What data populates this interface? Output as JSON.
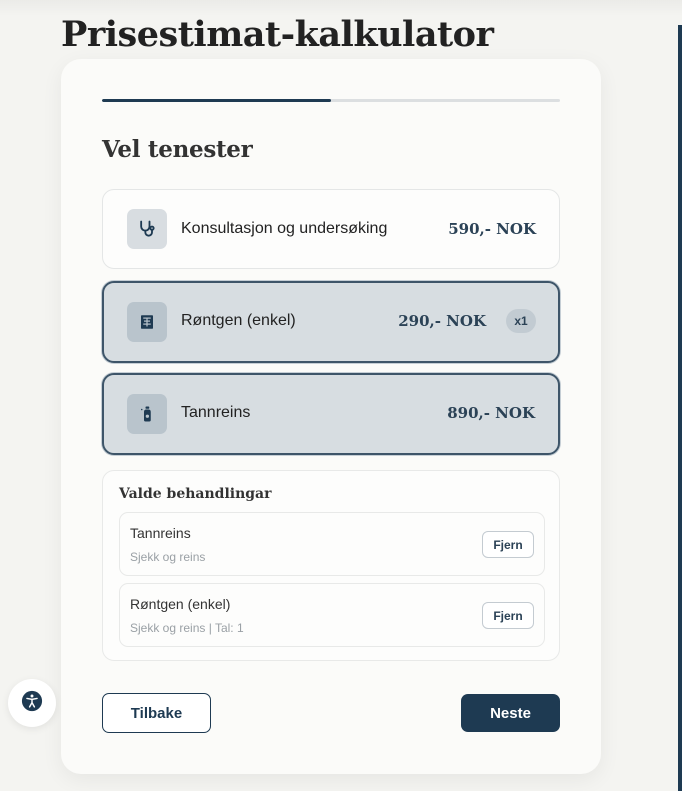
{
  "page": {
    "title": "Prisestimat-kalkulator"
  },
  "progress": {
    "value_fraction": 0.5
  },
  "section": {
    "title": "Vel tenester"
  },
  "services": [
    {
      "icon": "stethoscope-icon",
      "label": "Konsultasjon og undersøking",
      "price": "590,- NOK",
      "selected": false
    },
    {
      "icon": "xray-icon",
      "label": "Røntgen (enkel)",
      "price": "290,- NOK",
      "selected": true,
      "quantity_badge": "x1"
    },
    {
      "icon": "cleaning-bottle-icon",
      "label": "Tannreins",
      "price": "890,- NOK",
      "selected": true
    }
  ],
  "chosen": {
    "title": "Valde behandlingar",
    "items": [
      {
        "name": "Tannreins",
        "sub": "Sjekk og reins",
        "remove_label": "Fjern"
      },
      {
        "name": "Røntgen (enkel)",
        "sub": "Sjekk og reins | Tal: 1",
        "remove_label": "Fjern"
      }
    ]
  },
  "nav": {
    "back_label": "Tilbake",
    "next_label": "Neste"
  },
  "accessibility": {
    "icon": "accessibility-icon"
  },
  "colors": {
    "accent": "#1e3a52",
    "selected_bg": "#d7dde1",
    "page_bg": "#f4f4f1"
  }
}
